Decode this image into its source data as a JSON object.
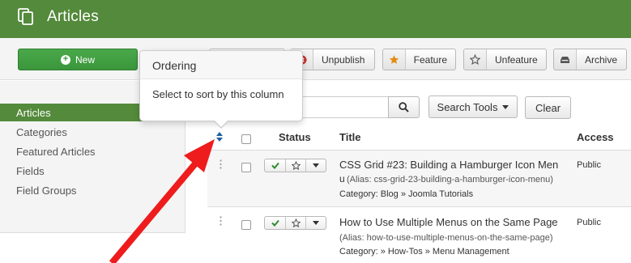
{
  "header": {
    "title": "Articles"
  },
  "toolbar": {
    "new_label": "New",
    "unpublish_label": "Unpublish",
    "feature_label": "Feature",
    "unfeature_label": "Unfeature",
    "archive_label": "Archive"
  },
  "popover": {
    "title": "Ordering",
    "content": "Select to sort by this column"
  },
  "sidebar": {
    "items": [
      {
        "label": "Articles",
        "active": true
      },
      {
        "label": "Categories"
      },
      {
        "label": "Featured Articles"
      },
      {
        "label": "Fields"
      },
      {
        "label": "Field Groups"
      }
    ]
  },
  "filters": {
    "search_tools_label": "Search Tools",
    "clear_label": "Clear"
  },
  "table": {
    "columns": {
      "status": "Status",
      "title": "Title",
      "access": "Access"
    },
    "rows": [
      {
        "title_line1": "CSS Grid #23: Building a Hamburger Icon Men",
        "title_line2": "u",
        "alias": "(Alias: css-grid-23-building-a-hamburger-icon-menu)",
        "category": "Category: Blog » Joomla Tutorials",
        "access": "Public"
      },
      {
        "title_line1": "How to Use Multiple Menus on the Same Page",
        "alias": "(Alias: how-to-use-multiple-menus-on-the-same-page)",
        "category": "Category: » How-Tos » Menu Management",
        "access": "Public"
      }
    ]
  },
  "colors": {
    "brand_green": "#548a3b",
    "new_button": "#3b963b",
    "annotation_red": "#ee1c1c",
    "published_check": "#2e8b2e",
    "feature_star": "#e38d13"
  },
  "icons": {
    "header": "articles-copy-icon",
    "new": "plus-circle-icon",
    "unpublish": "times-circle-icon",
    "feature": "star-filled-icon",
    "unfeature": "star-outline-icon",
    "archive": "archive-icon",
    "search": "search-icon",
    "ordering": "sort-icon"
  }
}
